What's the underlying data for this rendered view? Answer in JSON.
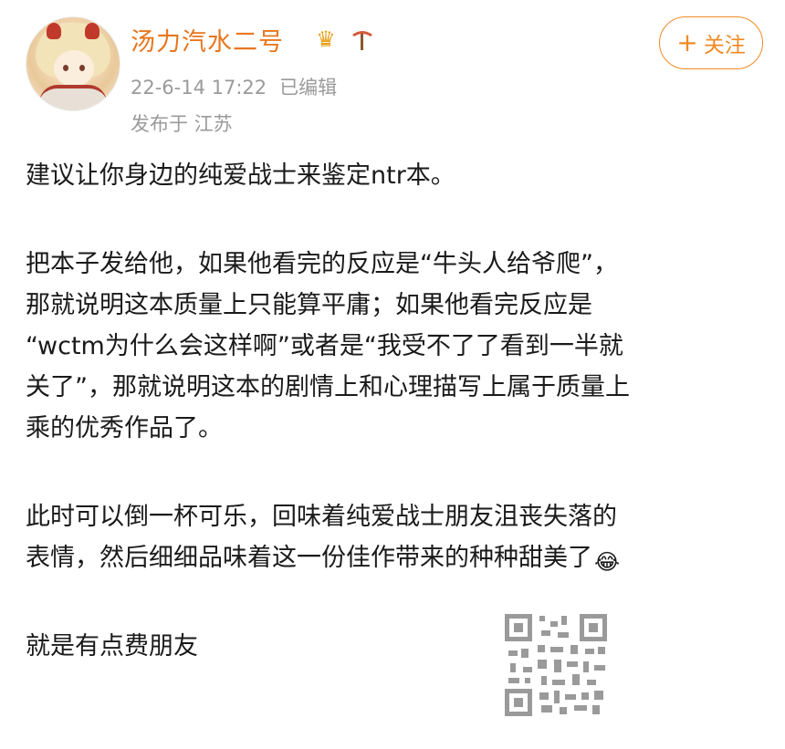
{
  "post": {
    "username": "汤力汽水二号",
    "badges": [
      "crown-badge",
      "pickaxe-badge"
    ],
    "timestamp": "22-6-14 17:22",
    "edited_label": "已编辑",
    "location": "发布于 江苏",
    "follow_label": "关注"
  },
  "content": {
    "p1": "建议让你身边的纯爱战士来鉴定ntr本。",
    "p2_line1": "把本子发给他，如果他看完的反应是“牛头人给爷爬”，",
    "p2_line2": "那就说明这本质量上只能算平庸；如果他看完反应是",
    "p2_line3": "“wctm为什么会这样啊”或者是“我受不了了看到一半就",
    "p2_line4": "关了”，那就说明这本的剧情上和心理描写上属于质量上",
    "p2_line5": "乘的优秀作品了。",
    "p3_line1": "此时可以倒一杯可乐，回味着纯爱战士朋友沮丧失落的",
    "p3_line2": "表情，然后细细品味着这一份佳作带来的种种甜美了",
    "p4": "就是有点费朋友"
  },
  "colors": {
    "username": "#e8761e",
    "follow": "#f08a24",
    "meta": "#9a9a9a",
    "text": "#1a1a1a"
  },
  "icons": {
    "emoji": "laughing-tears-emoji",
    "qr": "qr-code"
  }
}
